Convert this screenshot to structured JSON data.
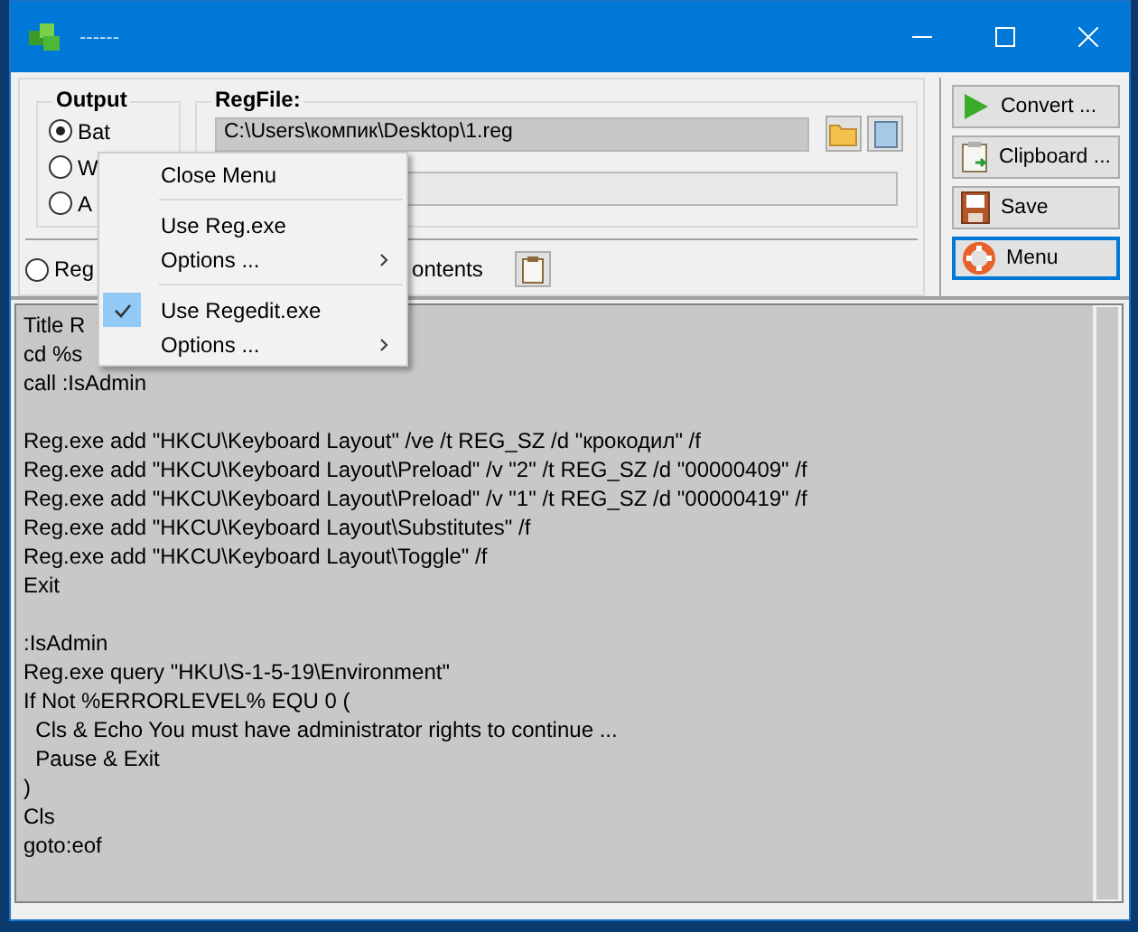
{
  "window": {
    "title": "------"
  },
  "output_group": {
    "label": "Output",
    "options": [
      {
        "label": "Bat",
        "selected": true
      },
      {
        "label": "W",
        "selected": false
      },
      {
        "label": "A",
        "selected": false
      }
    ]
  },
  "regfile_group": {
    "label": "RegFile:",
    "path": "C:\\Users\\компик\\Desktop\\1.reg"
  },
  "option_row": {
    "radio": {
      "label": "Reg",
      "selected": false
    },
    "text": "ontents"
  },
  "buttons": [
    {
      "label": "Convert ...",
      "focused": false
    },
    {
      "label": "Clipboard ...",
      "focused": false
    },
    {
      "label": "Save",
      "focused": false
    },
    {
      "label": "Menu",
      "focused": true
    }
  ],
  "editor": {
    "blocks": [
      [
        "Title R",
        "cd %s",
        "call :IsAdmin"
      ],
      [
        "Reg.exe add \"HKCU\\Keyboard Layout\" /ve /t REG_SZ /d \"крокодил\" /f",
        "Reg.exe add \"HKCU\\Keyboard Layout\\Preload\" /v \"2\" /t REG_SZ /d \"00000409\" /f",
        "Reg.exe add \"HKCU\\Keyboard Layout\\Preload\" /v \"1\" /t REG_SZ /d \"00000419\" /f",
        "Reg.exe add \"HKCU\\Keyboard Layout\\Substitutes\" /f",
        "Reg.exe add \"HKCU\\Keyboard Layout\\Toggle\" /f",
        "Exit"
      ],
      [
        ":IsAdmin",
        "Reg.exe query \"HKU\\S-1-5-19\\Environment\"",
        "If Not %ERRORLEVEL% EQU 0 (",
        "  Cls & Echo You must have administrator rights to continue ...",
        "  Pause & Exit",
        ")",
        "Cls",
        "goto:eof"
      ]
    ]
  },
  "context_menu": {
    "items": [
      {
        "kind": "item",
        "label": "Close Menu",
        "checked": false,
        "submenu": false
      },
      {
        "kind": "separator"
      },
      {
        "kind": "item",
        "label": "Use Reg.exe",
        "checked": false,
        "submenu": false
      },
      {
        "kind": "item",
        "label": "Options ...",
        "checked": false,
        "submenu": true
      },
      {
        "kind": "separator"
      },
      {
        "kind": "item",
        "label": "Use Regedit.exe",
        "checked": true,
        "submenu": false
      },
      {
        "kind": "item",
        "label": "Options ...",
        "checked": false,
        "submenu": true
      }
    ]
  }
}
